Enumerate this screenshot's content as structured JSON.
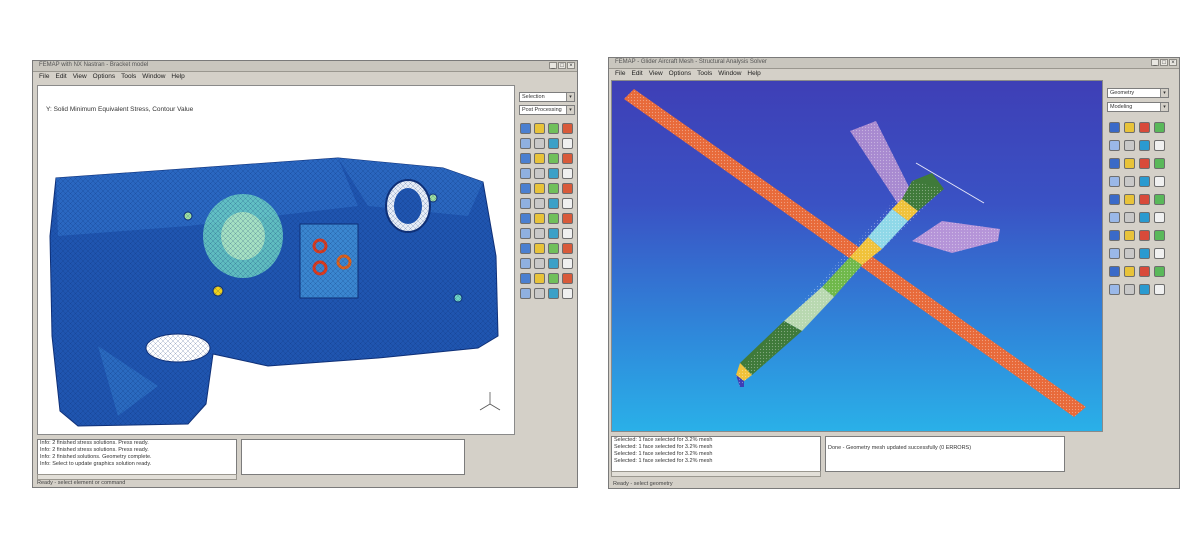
{
  "left_window": {
    "title": "FEMAP with NX Nastran - Bracket model",
    "menu": [
      "File",
      "Edit",
      "View",
      "Options",
      "Tools",
      "Window",
      "Help"
    ],
    "view_title": "Y: Solid Minimum Equivalent Stress, Contour Value",
    "combo_1": "Selection",
    "combo_2": "Post Processing",
    "console_lines": [
      "Info: 2 finished stress solutions. Press ready.",
      "Info: 2 finished stress solutions. Press ready.",
      "Info: 2 finished solutions. Geometry complete.",
      "Info: Select to update graphics solution ready."
    ],
    "status": "Ready - select element or command",
    "colors": {
      "mesh_base": "#1f55b0",
      "hot": "#e03a1a",
      "mid": "#5fd1c0"
    }
  },
  "right_window": {
    "title": "FEMAP - Glider Aircraft Mesh - Structural Analysis Solver",
    "menu": [
      "File",
      "Edit",
      "View",
      "Options",
      "Tools",
      "Window",
      "Help"
    ],
    "combo_1": "Geometry",
    "combo_2": "Modeling",
    "console_lines": [
      "Selected: 1 face selected for 3.2% mesh",
      "Selected: 1 face selected for 3.2% mesh",
      "Selected: 1 face selected for 3.2% mesh",
      "Selected: 1 face selected for 3.2% mesh"
    ],
    "console_right": "Done - Geometry mesh updated successfully (0 ERRORS)",
    "status": "Ready - select geometry",
    "colors": {
      "bg_top": "#3e3fb6",
      "bg_bottom": "#2ab0e8",
      "wing": "#e86a3a",
      "tail": "#b594d8"
    }
  }
}
